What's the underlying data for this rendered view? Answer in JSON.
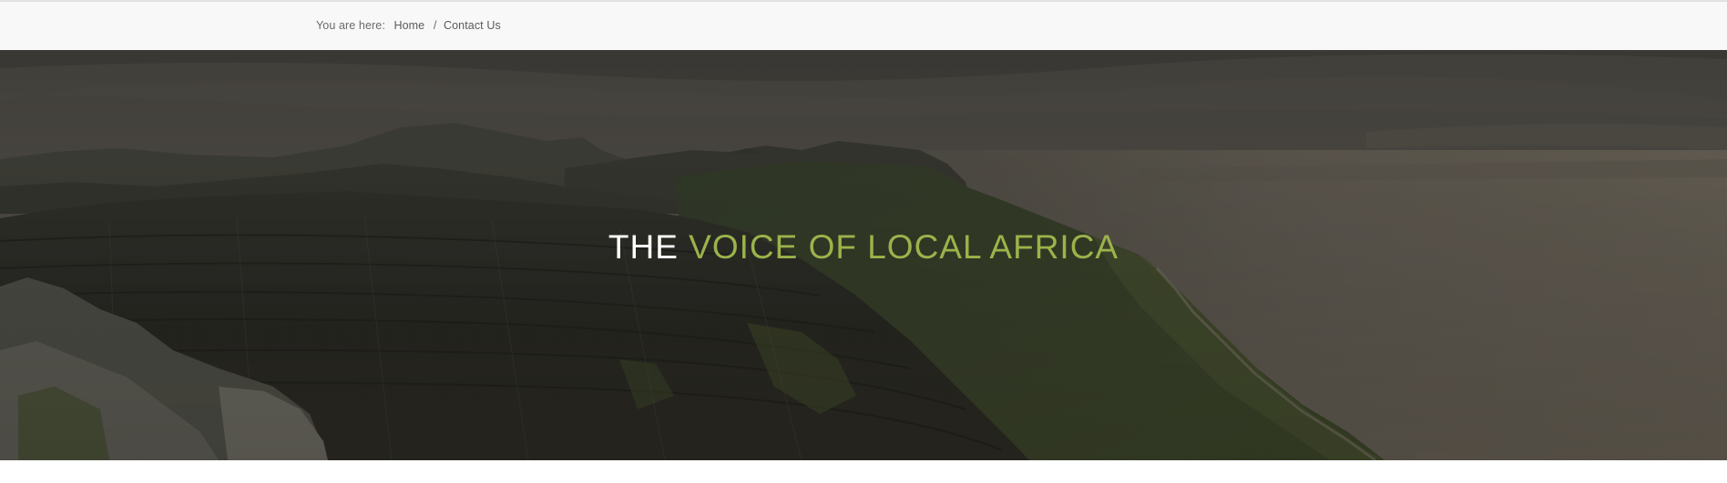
{
  "breadcrumb": {
    "prefix": "You are here:",
    "items": [
      {
        "label": "Home"
      },
      {
        "label": "Contact Us"
      }
    ],
    "separator": "/"
  },
  "hero": {
    "title_lead": "THE",
    "title_accent": "VOICE OF LOCAL AFRICA",
    "image_subject": "mountain-coastline-landscape"
  },
  "colors": {
    "accent": "#9bb34a",
    "breadcrumb_bg": "#f8f8f8",
    "title_lead": "#ffffff"
  }
}
